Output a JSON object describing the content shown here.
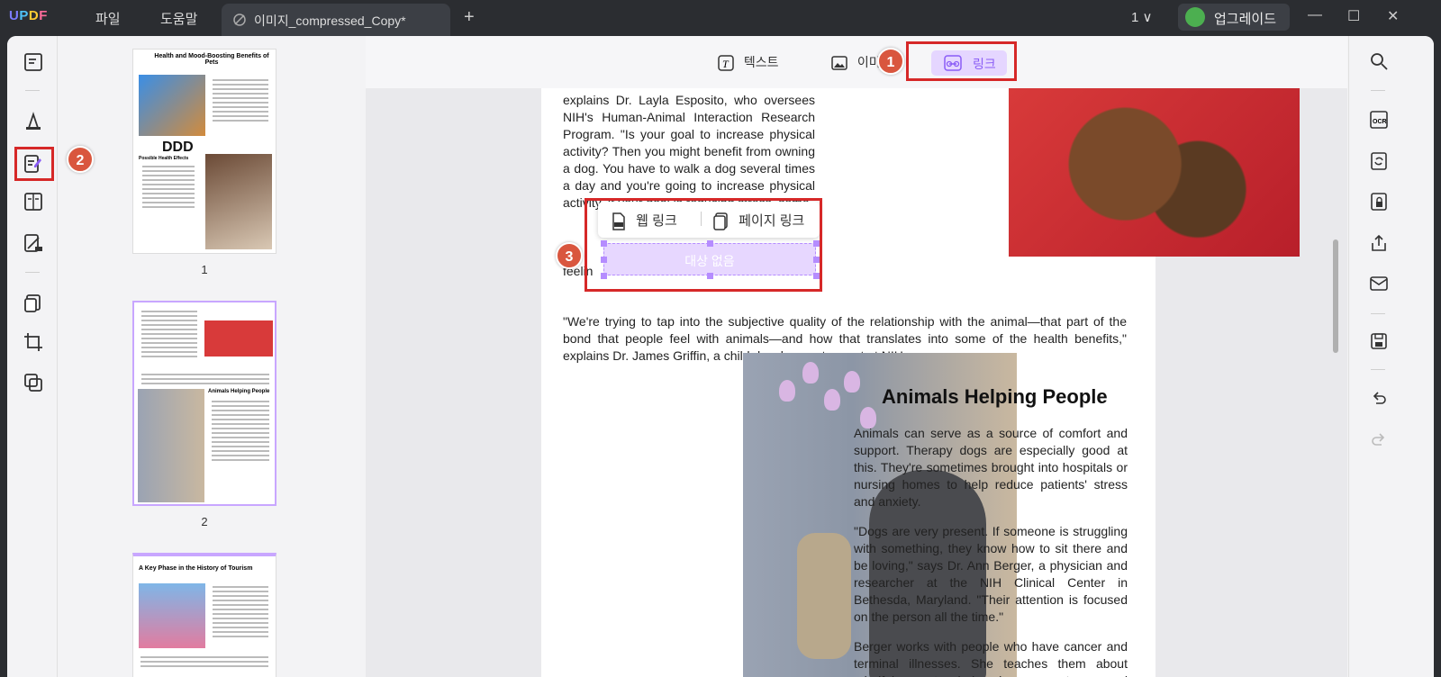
{
  "app": {
    "logo": [
      "U",
      "P",
      "D",
      "F"
    ],
    "menu": {
      "file": "파일",
      "help": "도움말"
    },
    "tab_title": "이미지_compressed_Copy*",
    "tab_close": "×",
    "new_tab": "+",
    "page_selector": "1 ∨",
    "upgrade_label": "업그레이드",
    "window": {
      "minimize": "—",
      "maximize": "☐",
      "close": "✕"
    }
  },
  "toolbar": {
    "text_label": "텍스트",
    "image_label": "이미",
    "link_label": "링크"
  },
  "thumbnails": [
    {
      "number": "1",
      "title": "Health and Mood-Boosting Benefits of Pets",
      "subtitle": "Possible Health Effects",
      "overlay": "DDD"
    },
    {
      "number": "2",
      "title": "Animals Helping People"
    },
    {
      "number": "",
      "title": "A Key Phase in the History of Tourism"
    }
  ],
  "document": {
    "para1": "explains Dr. Layla Esposito, who oversees NIH's Human-Animal Interaction Research Program. \"Is your goal to increase physical activity? Then you might benefit from owning a dog. You have to walk a dog several times a day and you're going to increase physical activity. If your goal is reducing stress, some",
    "para1_fragment": "feelin",
    "para2": "\"We're trying to tap into the subjective quality of the relationship with the animal—that part of the bond that people feel with animals—and how that translates into some of the health benefits,\" explains Dr. James Griffin, a child development expert at NIH.",
    "heading": "Animals Helping People",
    "para3": "Animals can serve as a source of comfort and support. Therapy dogs are especially good at this. They're sometimes brought into hospitals or nursing homes to help reduce patients' stress and anxiety.",
    "para4": "\"Dogs are very present. If someone is struggling with something, they know how to sit there and be loving,\" says Dr. Ann Berger, a physician and researcher at the NIH Clinical Center in Bethesda, Maryland. \"Their attention is focused on the person all the time.\"",
    "para5": "Berger works with people who have cancer and terminal illnesses. She teaches them about mindfulness to help decrease stress and manage pain."
  },
  "link_popup": {
    "web_link": "웹 링크",
    "page_link": "페이지 링크"
  },
  "link_box_text": "대상 없음",
  "annotations": {
    "step1": "1",
    "step2": "2",
    "step3": "3"
  },
  "colors": {
    "accent": "#8a5cf6",
    "link_fill": "#e7d7ff",
    "highlight_box": "#d62828",
    "badge": "#d9563e"
  }
}
